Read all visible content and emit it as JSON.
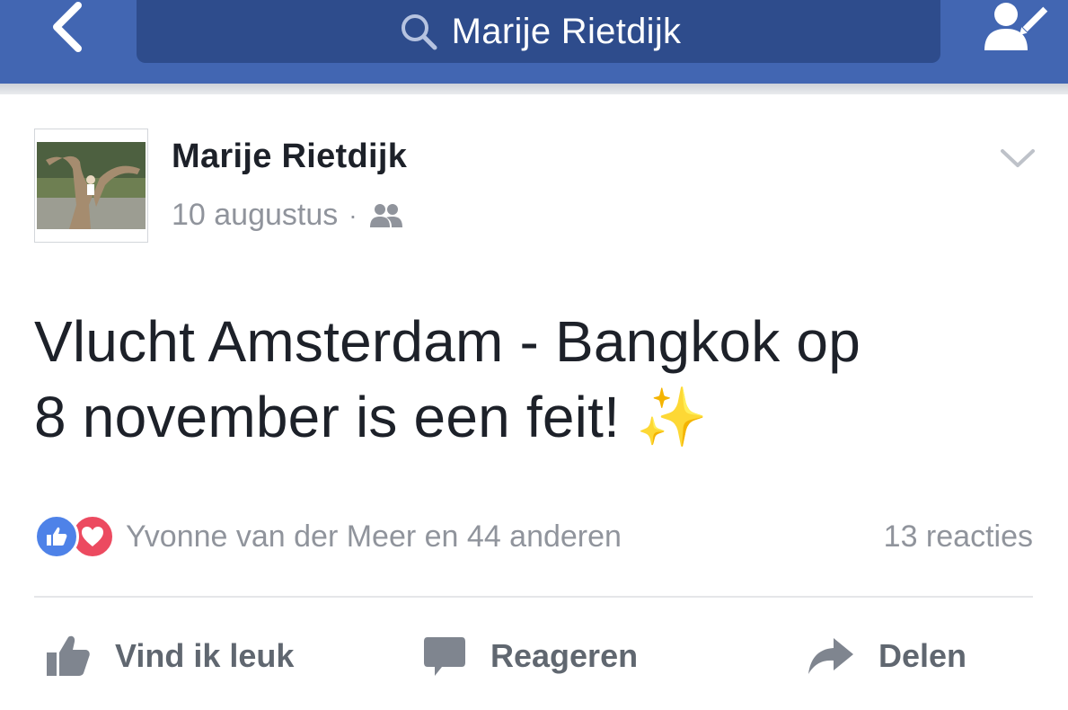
{
  "header": {
    "search_query": "Marije Rietdijk"
  },
  "post": {
    "author": "Marije Rietdijk",
    "date": "10 augustus",
    "meta_separator": "·",
    "audience_icon": "friends-icon",
    "text_line1": "Vlucht Amsterdam - Bangkok op",
    "text_line2": "8 november is een feit!",
    "emoji": "✨"
  },
  "reactions": {
    "summary": "Yvonne van der Meer en 44 anderen",
    "comments": "13 reacties"
  },
  "actions": {
    "like": "Vind ik leuk",
    "comment": "Reageren",
    "share": "Delen"
  },
  "colors": {
    "header_bg": "#4266b2",
    "search_bg": "#2e4c8c",
    "like_blue": "#4e82e8",
    "love_red": "#ec4a60",
    "muted_text": "#90949c"
  }
}
